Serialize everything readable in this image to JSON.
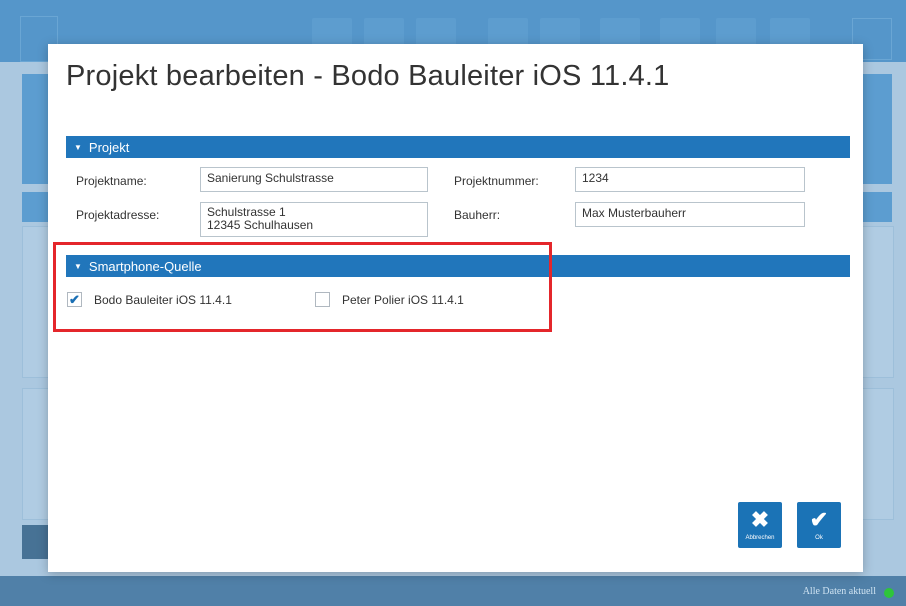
{
  "modal": {
    "title": "Projekt bearbeiten - Bodo Bauleiter iOS 11.4.1"
  },
  "project_section": {
    "header": "Projekt",
    "fields": {
      "projektname_label": "Projektname:",
      "projektname_value": "Sanierung Schulstrasse",
      "projektnummer_label": "Projektnummer:",
      "projektnummer_value": "1234",
      "projektadresse_label": "Projektadresse:",
      "projektadresse_value": "Schulstrasse 1\n12345 Schulhausen",
      "bauherr_label": "Bauherr:",
      "bauherr_value": "Max Musterbauherr"
    }
  },
  "smartphone_section": {
    "header": "Smartphone-Quelle",
    "sources": [
      {
        "label": "Bodo Bauleiter iOS 11.4.1",
        "checked": true
      },
      {
        "label": "Peter Polier iOS 11.4.1",
        "checked": false
      }
    ]
  },
  "actions": {
    "cancel_label": "Abbrechen",
    "ok_label": "Ok"
  },
  "status_bar": {
    "text": "Alle Daten aktuell",
    "indicator_color": "#2ec53a"
  },
  "icons": {
    "section_caret": "caret-down-icon",
    "cancel": "close-icon",
    "ok": "checkmark-icon"
  }
}
